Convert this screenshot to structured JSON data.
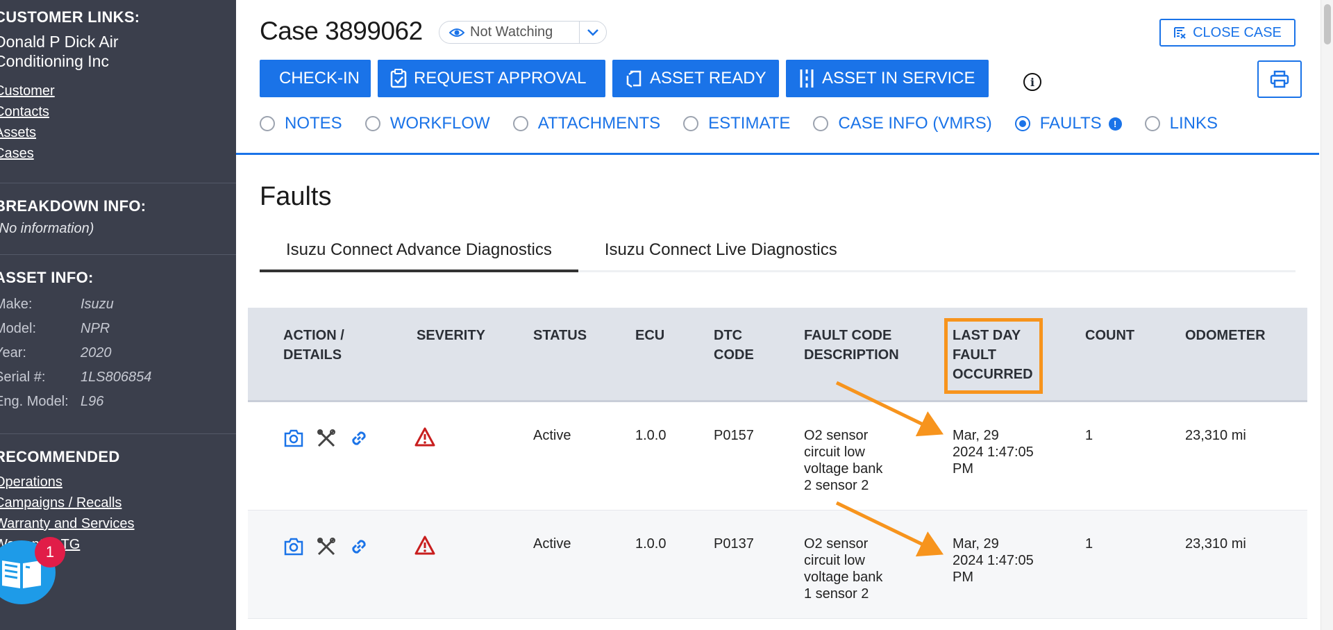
{
  "sidebar": {
    "customer_links_title": "CUSTOMER LINKS:",
    "company_line1": "Donald P Dick Air",
    "company_line2": "Conditioning Inc",
    "links": [
      "Customer",
      "Contacts",
      "Assets",
      "Cases"
    ],
    "breakdown_title": "BREAKDOWN INFO:",
    "breakdown_value": "(No information)",
    "asset_title": "ASSET INFO:",
    "asset_rows": [
      {
        "key": "Make:",
        "value": "Isuzu"
      },
      {
        "key": "Model:",
        "value": "NPR"
      },
      {
        "key": "Year:",
        "value": "2020"
      },
      {
        "key": "Serial #:",
        "value": "1LS806854"
      },
      {
        "key": "Eng. Model:",
        "value": "L96"
      }
    ],
    "recommended_title": "RECOMMENDED",
    "recommended_links": [
      "Operations",
      "Campaigns / Recalls",
      "Warranty and Services",
      "Warranty LTG"
    ],
    "help_badge_count": "1"
  },
  "header": {
    "case_title": "Case 3899062",
    "watch_label": "Not Watching",
    "close_case_label": "CLOSE CASE"
  },
  "actions": {
    "checkin": "CHECK-IN",
    "request_approval": "REQUEST APPROVAL",
    "asset_ready": "ASSET READY",
    "asset_in_service": "ASSET IN SERVICE"
  },
  "tabs": [
    {
      "label": "NOTES",
      "selected": false
    },
    {
      "label": "WORKFLOW",
      "selected": false
    },
    {
      "label": "ATTACHMENTS",
      "selected": false
    },
    {
      "label": "ESTIMATE",
      "selected": false
    },
    {
      "label": "CASE INFO (VMRS)",
      "selected": false
    },
    {
      "label": "FAULTS",
      "selected": true,
      "badge": "!"
    },
    {
      "label": "LINKS",
      "selected": false
    }
  ],
  "faults": {
    "title": "Faults",
    "subtabs": [
      "Isuzu Connect Advance Diagnostics",
      "Isuzu Connect Live Diagnostics"
    ],
    "active_subtab": 0,
    "columns": {
      "action": [
        "ACTION /",
        "DETAILS"
      ],
      "severity": [
        "SEVERITY"
      ],
      "status": [
        "STATUS"
      ],
      "ecu": [
        "ECU"
      ],
      "dtc": [
        "DTC",
        "CODE"
      ],
      "description": [
        "FAULT CODE",
        "DESCRIPTION"
      ],
      "last_day": [
        "LAST DAY",
        "FAULT",
        "OCCURRED"
      ],
      "count": [
        "COUNT"
      ],
      "odometer": [
        "ODOMETER"
      ]
    },
    "rows": [
      {
        "status": "Active",
        "ecu": "1.0.0",
        "dtc": "P0157",
        "description": [
          "O2 sensor",
          "circuit low",
          "voltage bank",
          "2 sensor 2"
        ],
        "last_day": [
          "Mar, 29",
          "2024 1:47:05",
          "PM"
        ],
        "count": "1",
        "odometer": "23,310 mi"
      },
      {
        "status": "Active",
        "ecu": "1.0.0",
        "dtc": "P0137",
        "description": [
          "O2 sensor",
          "circuit low",
          "voltage bank",
          "1 sensor 2"
        ],
        "last_day": [
          "Mar, 29",
          "2024 1:47:05",
          "PM"
        ],
        "count": "1",
        "odometer": "23,310 mi"
      }
    ]
  },
  "colors": {
    "primary": "#1a73e8",
    "sidebar_bg": "#3b3f4c",
    "highlight": "#f7941d",
    "severity": "#c81e1e"
  }
}
